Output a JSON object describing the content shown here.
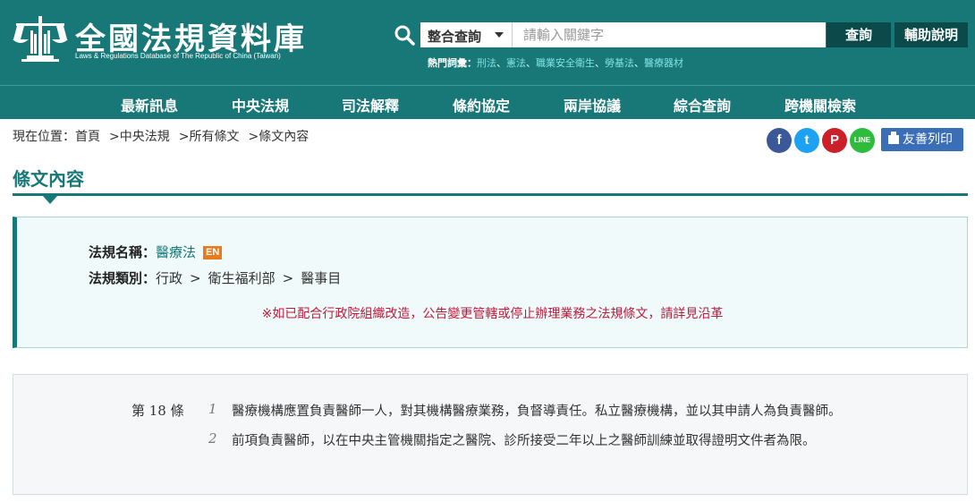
{
  "header": {
    "title": "全國法規資料庫",
    "subtitle": "Laws & Regulations Database of The Republic of China (Taiwan)",
    "search": {
      "select_value": "整合查詢",
      "placeholder": "請輸入關鍵字",
      "query_label": "查詢",
      "help_label": "輔助說明"
    },
    "hot_terms_label": "熱門詞彙：",
    "hot_terms": [
      "刑法",
      "憲法",
      "職業安全衛生",
      "勞基法",
      "醫療器材"
    ],
    "hot_sep": "、"
  },
  "nav": {
    "items": [
      "最新訊息",
      "中央法規",
      "司法解釋",
      "條約協定",
      "兩岸協議",
      "綜合查詢",
      "跨機關檢索"
    ]
  },
  "breadcrumb": {
    "prefix": "現在位置：",
    "items": [
      "首頁",
      "中央法規",
      "所有條文",
      "條文內容"
    ],
    "sep": ">"
  },
  "share": {
    "facebook": "f",
    "twitter": "t",
    "pinterest": "P",
    "line": "LINE",
    "print_label": "友善列印"
  },
  "section_title": "條文內容",
  "law_info": {
    "name_label": "法規名稱：",
    "name": "醫療法",
    "en_badge": "EN",
    "category_label": "法規類別：",
    "categories": [
      "行政",
      "衛生福利部",
      "醫事目"
    ],
    "category_sep": ">",
    "notice": "※如已配合行政院組織改造，公告變更管轄或停止辦理業務之法規條文，請詳見沿革"
  },
  "article": {
    "number": "第 18 條",
    "paragraphs": [
      {
        "num": "1",
        "text": "醫療機構應置負責醫師一人，對其機構醫療業務，負督導責任。私立醫療機構，並以其申請人為負責醫師。"
      },
      {
        "num": "2",
        "text": "前項負責醫師，以在中央主管機關指定之醫院、診所接受二年以上之醫師訓練並取得證明文件者為限。"
      }
    ]
  },
  "colors": {
    "brand": "#187878",
    "notice": "#c0193a",
    "en_badge": "#e8791c"
  }
}
